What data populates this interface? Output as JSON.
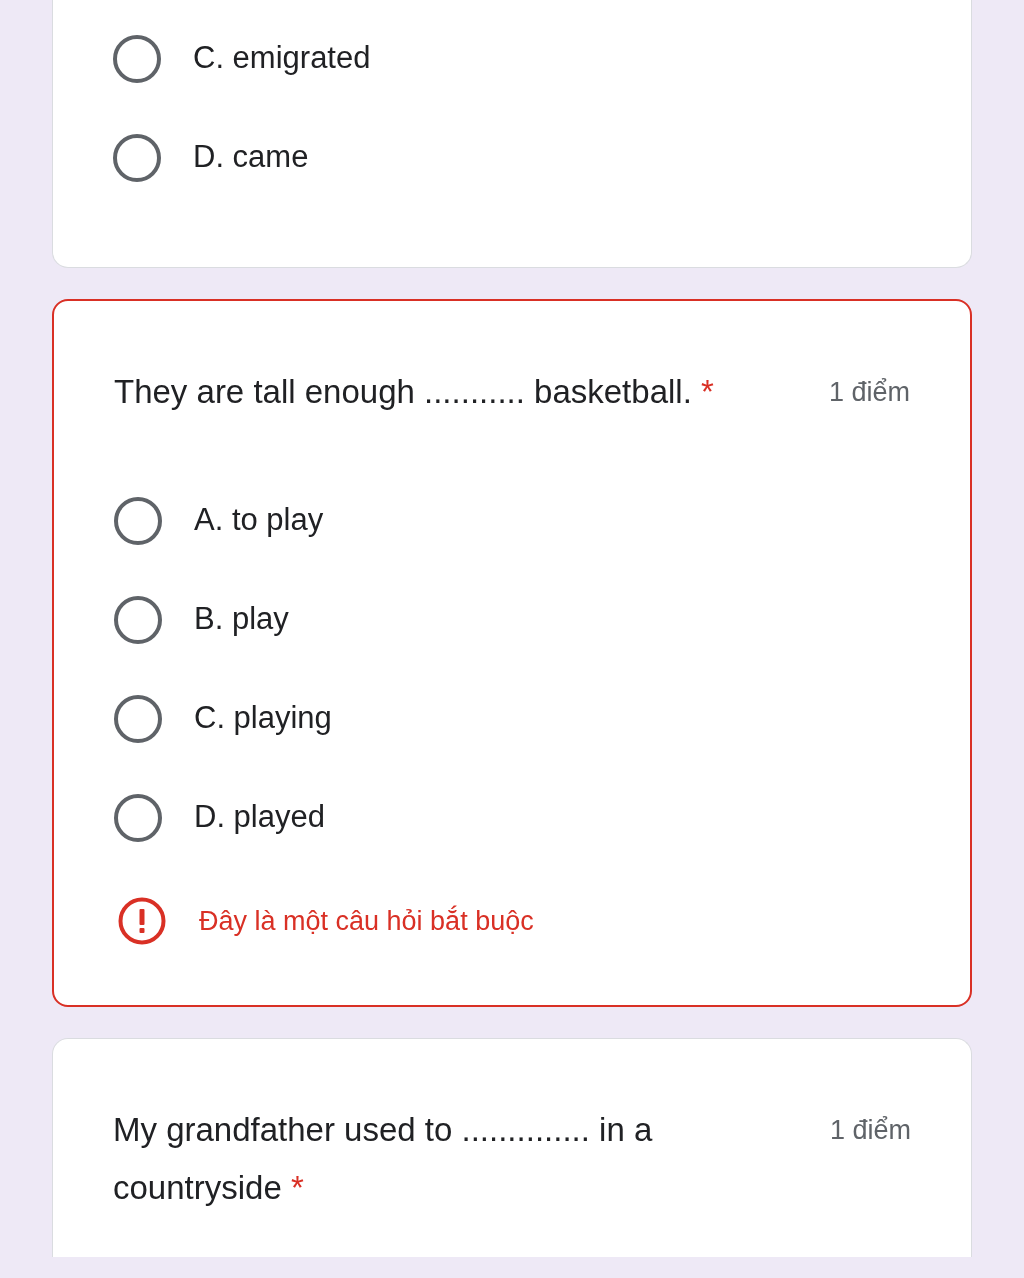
{
  "questions": [
    {
      "options": [
        {
          "label": "C. emigrated",
          "selected": false
        },
        {
          "label": "D. came",
          "selected": false
        }
      ]
    },
    {
      "title": "They are tall enough ........... basketball.",
      "required_mark": "*",
      "points": "1 điểm",
      "options": [
        {
          "label": "A. to play",
          "selected": false
        },
        {
          "label": "B. play",
          "selected": false
        },
        {
          "label": "C. playing",
          "selected": false
        },
        {
          "label": "D. played",
          "selected": false
        }
      ],
      "error": "Đây là một câu hỏi bắt buộc"
    },
    {
      "title": "My grandfather used to .............. in a countryside",
      "required_mark": "*",
      "points": "1 điểm"
    }
  ]
}
